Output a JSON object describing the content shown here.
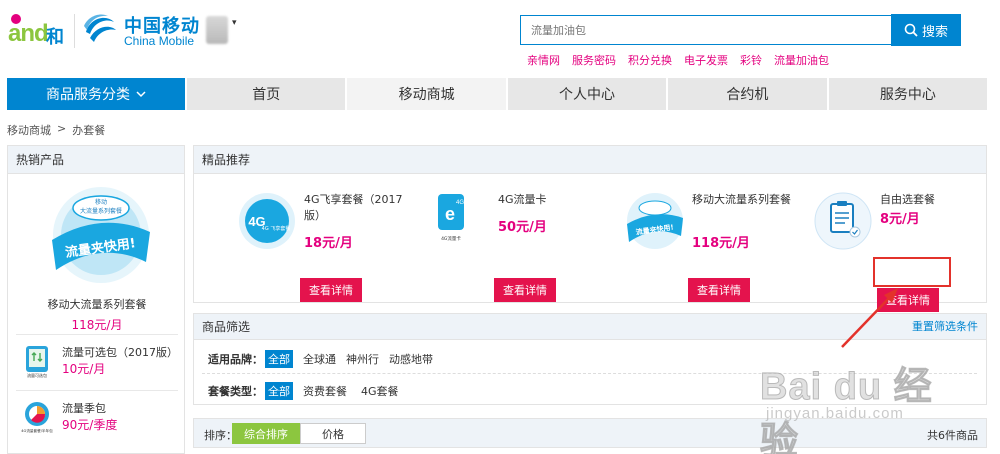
{
  "header": {
    "brand_and": "and",
    "brand_he": "和",
    "brand_cn": "中国移动",
    "brand_en": "China Mobile",
    "city_arrow": "▾",
    "search_placeholder": "流量加油包",
    "search_button": "搜索",
    "hot_words": [
      "亲情网",
      "服务密码",
      "积分兑换",
      "电子发票",
      "彩铃",
      "流量加油包"
    ]
  },
  "nav": {
    "category_label": "商品服务分类",
    "category_icon": "chevron-down-icon",
    "items": [
      "首页",
      "移动商城",
      "个人中心",
      "合约机",
      "服务中心"
    ],
    "active_index": 1
  },
  "breadcrumb": [
    "移动商城",
    ">",
    "办套餐"
  ],
  "sidebar": {
    "title": "热销产品",
    "promo_image_text": [
      "移动",
      "大流量系列套餐",
      "流量夹快用!"
    ],
    "promo_name": "移动大流量系列套餐",
    "promo_price": "118元/月",
    "items": [
      {
        "name": "流量可选包（2017版）",
        "price": "10元/月",
        "icon_caption": "流量可选包"
      },
      {
        "name": "流量季包",
        "price": "90元/季度",
        "icon_caption": "4G流量套餐/半年包"
      }
    ]
  },
  "recommend": {
    "title": "精品推荐",
    "items": [
      {
        "name": "4G飞享套餐（2017版）",
        "price": "18元/月",
        "button": "查看详情",
        "image_text": "4G 飞享套餐"
      },
      {
        "name": "4G流量卡",
        "price": "50元/月",
        "button": "查看详情",
        "image_text": "4G流量卡"
      },
      {
        "name": "移动大流量系列套餐",
        "price": "118元/月",
        "button": "查看详情",
        "image_text": "流量夹快用!"
      },
      {
        "name": "自由选套餐",
        "price": "8元/月",
        "button": "查看详情",
        "image_text": ""
      }
    ]
  },
  "filter": {
    "title": "商品筛选",
    "reset": "重置筛选条件",
    "rows": [
      {
        "label": "适用品牌：",
        "selected": "全部",
        "options": [
          "全球通",
          "神州行",
          "动感地带"
        ]
      },
      {
        "label": "套餐类型：",
        "selected": "全部",
        "options": [
          "资费套餐",
          "4G套餐"
        ]
      }
    ]
  },
  "sort": {
    "label": "排序：",
    "options": [
      "综合排序",
      "价格"
    ],
    "active": "综合排序",
    "count": "共6件商品"
  },
  "watermark": {
    "line1": "Bai du 经验",
    "line2": "jingyan.baidu.com"
  },
  "colors": {
    "brand_blue": "#0085d0",
    "price_pink": "#e4007f",
    "button_red": "#e4134d",
    "sort_green": "#8cc63f",
    "annotation_red": "#e3322b"
  }
}
